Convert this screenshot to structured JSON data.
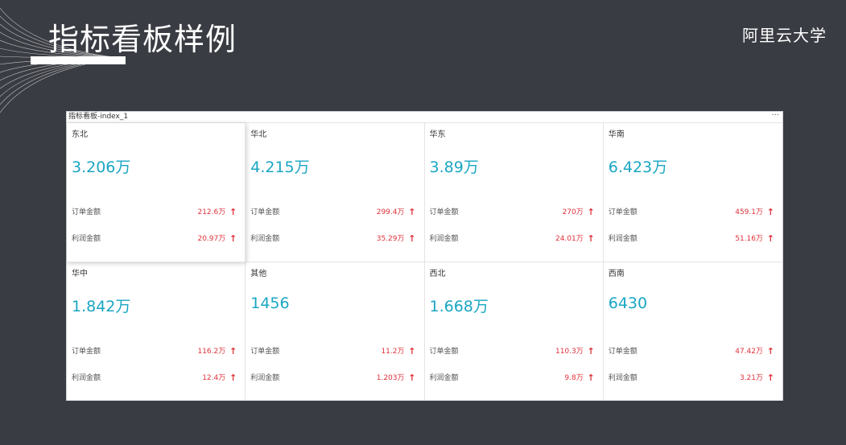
{
  "slide": {
    "title": "指标看板样例",
    "brand": "阿里云大学"
  },
  "dashboard": {
    "name": "指标看板-index_1",
    "more_label": "···",
    "order_label": "订单金额",
    "profit_label": "利润金额",
    "up_color": "#e0323b",
    "value_color": "#1aa6c3",
    "cards": [
      {
        "region": "东北",
        "value": "3.206万",
        "order": "212.6万",
        "profit": "20.97万",
        "order_trend": "up",
        "profit_trend": "up"
      },
      {
        "region": "华北",
        "value": "4.215万",
        "order": "299.4万",
        "profit": "35.29万",
        "order_trend": "up",
        "profit_trend": "up"
      },
      {
        "region": "华东",
        "value": "3.89万",
        "order": "270万",
        "profit": "24.01万",
        "order_trend": "up",
        "profit_trend": "up"
      },
      {
        "region": "华南",
        "value": "6.423万",
        "order": "459.1万",
        "profit": "51.16万",
        "order_trend": "up",
        "profit_trend": "up"
      },
      {
        "region": "华中",
        "value": "1.842万",
        "order": "116.2万",
        "profit": "12.4万",
        "order_trend": "up",
        "profit_trend": "up"
      },
      {
        "region": "其他",
        "value": "1456",
        "order": "11.2万",
        "profit": "1.203万",
        "order_trend": "up",
        "profit_trend": "up"
      },
      {
        "region": "西北",
        "value": "1.668万",
        "order": "110.3万",
        "profit": "9.8万",
        "order_trend": "up",
        "profit_trend": "up"
      },
      {
        "region": "西南",
        "value": "6430",
        "order": "47.42万",
        "profit": "3.21万",
        "order_trend": "up",
        "profit_trend": "up"
      }
    ]
  }
}
